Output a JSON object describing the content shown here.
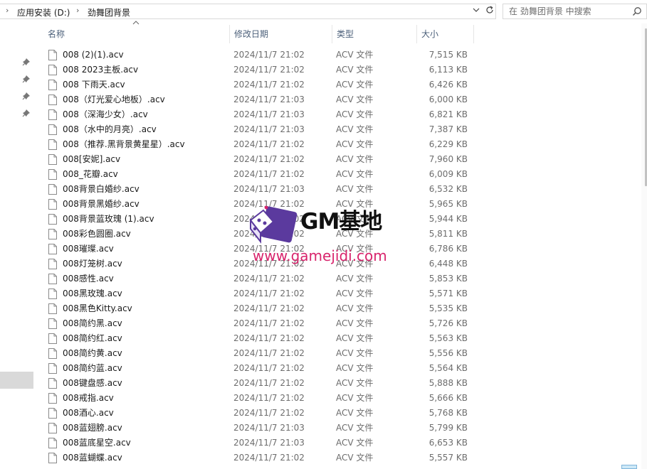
{
  "address_bar": {
    "crumbs": [
      "应用安装 (D:)",
      "劲舞团背景"
    ]
  },
  "search": {
    "placeholder": "在 劲舞团背景 中搜索"
  },
  "columns": {
    "name": "名称",
    "date": "修改日期",
    "type": "类型",
    "size": "大小"
  },
  "files": [
    {
      "name": "008 (2)(1).acv",
      "date": "2024/11/7 21:02",
      "type": "ACV 文件",
      "size": "7,515 KB"
    },
    {
      "name": "008 2023主板.acv",
      "date": "2024/11/7 21:02",
      "type": "ACV 文件",
      "size": "6,113 KB"
    },
    {
      "name": "008 下雨天.acv",
      "date": "2024/11/7 21:02",
      "type": "ACV 文件",
      "size": "6,426 KB"
    },
    {
      "name": "008（灯光爱心地板）.acv",
      "date": "2024/11/7 21:03",
      "type": "ACV 文件",
      "size": "6,000 KB"
    },
    {
      "name": "008（深海少女）.acv",
      "date": "2024/11/7 21:03",
      "type": "ACV 文件",
      "size": "6,821 KB"
    },
    {
      "name": "008（水中的月亮）.acv",
      "date": "2024/11/7 21:03",
      "type": "ACV 文件",
      "size": "7,387 KB"
    },
    {
      "name": "008（推荐.黑背景黄星星）.acv",
      "date": "2024/11/7 21:02",
      "type": "ACV 文件",
      "size": "6,229 KB"
    },
    {
      "name": "008[安妮].acv",
      "date": "2024/11/7 21:02",
      "type": "ACV 文件",
      "size": "7,960 KB"
    },
    {
      "name": "008_花瓣.acv",
      "date": "2024/11/7 21:02",
      "type": "ACV 文件",
      "size": "6,009 KB"
    },
    {
      "name": "008背景白婚纱.acv",
      "date": "2024/11/7 21:03",
      "type": "ACV 文件",
      "size": "6,532 KB"
    },
    {
      "name": "008背景黑婚纱.acv",
      "date": "2024/11/7 21:02",
      "type": "ACV 文件",
      "size": "5,965 KB"
    },
    {
      "name": "008背景蓝玫瑰 (1).acv",
      "date": "2024/11/7 21:02",
      "type": "ACV 文件",
      "size": "5,944 KB"
    },
    {
      "name": "008彩色圆圈.acv",
      "date": "2024/11/7 21:02",
      "type": "ACV 文件",
      "size": "5,811 KB"
    },
    {
      "name": "008璀璨.acv",
      "date": "2024/11/7 21:02",
      "type": "ACV 文件",
      "size": "6,786 KB"
    },
    {
      "name": "008灯笼树.acv",
      "date": "2024/11/7 21:02",
      "type": "ACV 文件",
      "size": "6,448 KB"
    },
    {
      "name": "008感性.acv",
      "date": "2024/11/7 21:02",
      "type": "ACV 文件",
      "size": "5,853 KB"
    },
    {
      "name": "008黑玫瑰.acv",
      "date": "2024/11/7 21:02",
      "type": "ACV 文件",
      "size": "5,571 KB"
    },
    {
      "name": "008黑色Kitty.acv",
      "date": "2024/11/7 21:02",
      "type": "ACV 文件",
      "size": "5,535 KB"
    },
    {
      "name": "008简约黑.acv",
      "date": "2024/11/7 21:02",
      "type": "ACV 文件",
      "size": "5,726 KB"
    },
    {
      "name": "008简约红.acv",
      "date": "2024/11/7 21:02",
      "type": "ACV 文件",
      "size": "5,563 KB"
    },
    {
      "name": "008简约黄.acv",
      "date": "2024/11/7 21:02",
      "type": "ACV 文件",
      "size": "5,556 KB"
    },
    {
      "name": "008简约蓝.acv",
      "date": "2024/11/7 21:02",
      "type": "ACV 文件",
      "size": "5,564 KB"
    },
    {
      "name": "008键盘感.acv",
      "date": "2024/11/7 21:02",
      "type": "ACV 文件",
      "size": "5,888 KB"
    },
    {
      "name": "008戒指.acv",
      "date": "2024/11/7 21:02",
      "type": "ACV 文件",
      "size": "5,666 KB"
    },
    {
      "name": "008酒心.acv",
      "date": "2024/11/7 21:02",
      "type": "ACV 文件",
      "size": "5,768 KB"
    },
    {
      "name": "008蓝翅膀.acv",
      "date": "2024/11/7 21:03",
      "type": "ACV 文件",
      "size": "5,799 KB"
    },
    {
      "name": "008蓝底星空.acv",
      "date": "2024/11/7 21:03",
      "type": "ACV 文件",
      "size": "6,653 KB"
    },
    {
      "name": "008蓝蝴蝶.acv",
      "date": "2024/11/7 21:02",
      "type": "ACV 文件",
      "size": "5,557 KB"
    }
  ],
  "watermark": {
    "brand": "GM基地",
    "url": "www.gamejidi.com",
    "logo_icon": "dice-cube-icon",
    "brand_color": "#d8246c",
    "logo_color": "#5b3a9e"
  }
}
